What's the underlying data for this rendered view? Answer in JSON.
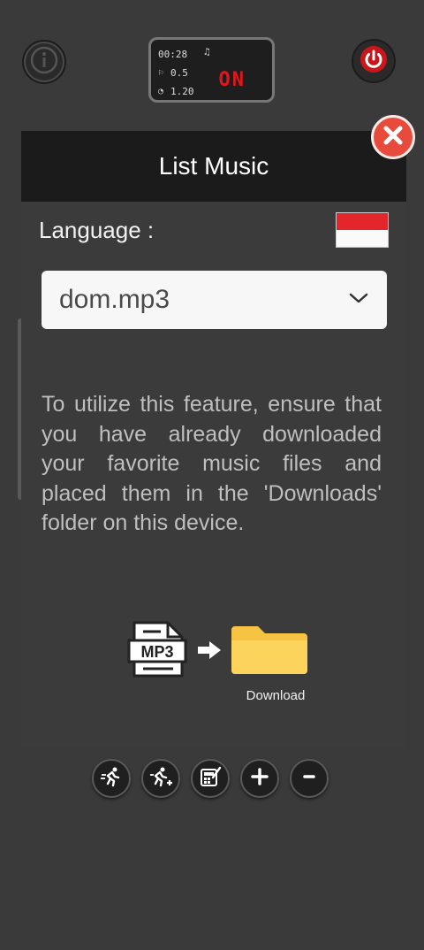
{
  "status": {
    "time": "00:28",
    "speed": "0.5",
    "incline": "1.20",
    "state": "ON"
  },
  "dialog": {
    "title": "List Music",
    "language_label": "Language :",
    "selected_file": "dom.mp3",
    "description": "To utilize this feature, ensure that you have already downloaded your favorite music files and placed them in the 'Downloads' folder on this device.",
    "illustration": {
      "file_label": "MP3",
      "folder_label": "Download"
    }
  },
  "colors": {
    "background": "#3a3a3a",
    "header": "#1b1b1b",
    "close": "#e84b3c",
    "power": "#e1161c",
    "display_on": "#e1161c",
    "folder": "#fcd45c"
  },
  "toolbar": {
    "icons": [
      "runner-icon",
      "runner-add-icon",
      "calculator-edit-icon",
      "plus-icon",
      "minus-icon"
    ]
  }
}
